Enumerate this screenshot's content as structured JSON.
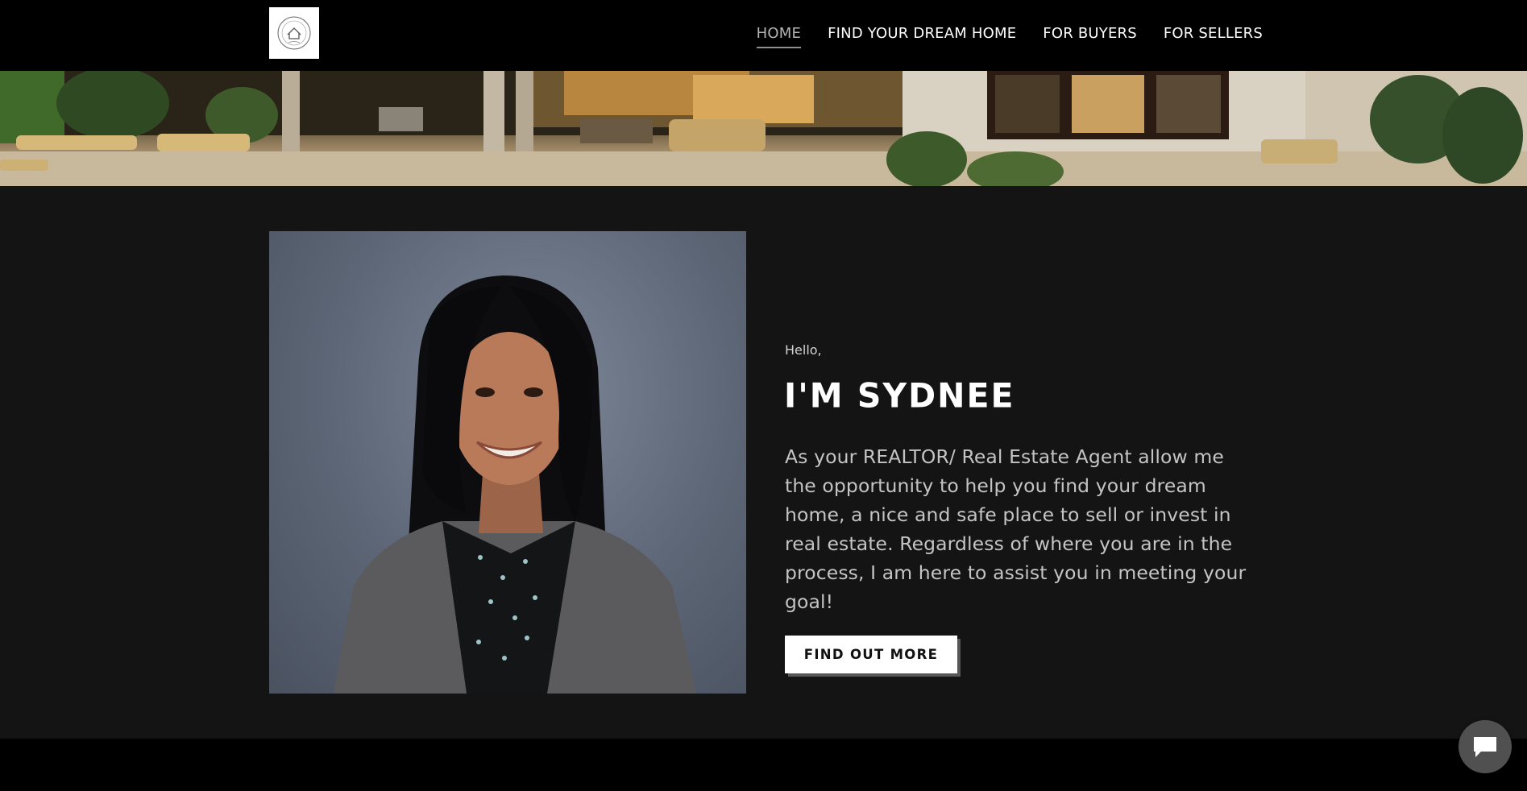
{
  "header": {
    "logo_icon": "house-seal-icon",
    "nav": [
      {
        "label": "HOME",
        "active": true
      },
      {
        "label": "FIND YOUR DREAM HOME",
        "active": false
      },
      {
        "label": "FOR BUYERS",
        "active": false
      },
      {
        "label": "FOR SELLERS",
        "active": false
      }
    ]
  },
  "banner": {
    "image": "luxury-patio-photo"
  },
  "about": {
    "photo": "agent-headshot-photo",
    "greeting": "Hello,",
    "headline": "I'M SYDNEE",
    "bio": "As your REALTOR/ Real Estate Agent allow me the opportunity to help you find your dream home, a nice and safe place to sell or invest in real estate. Regardless of where you are in the process, I am here to assist you in meeting your goal!",
    "cta_label": "FIND OUT MORE"
  },
  "chat": {
    "icon": "chat-bubble-icon"
  },
  "colors": {
    "header_bg": "#000000",
    "section_bg": "#141414",
    "text": "#ffffff",
    "bio_text": "#c4c4c4",
    "cta_bg": "#ffffff",
    "chat_bg": "#505050"
  }
}
